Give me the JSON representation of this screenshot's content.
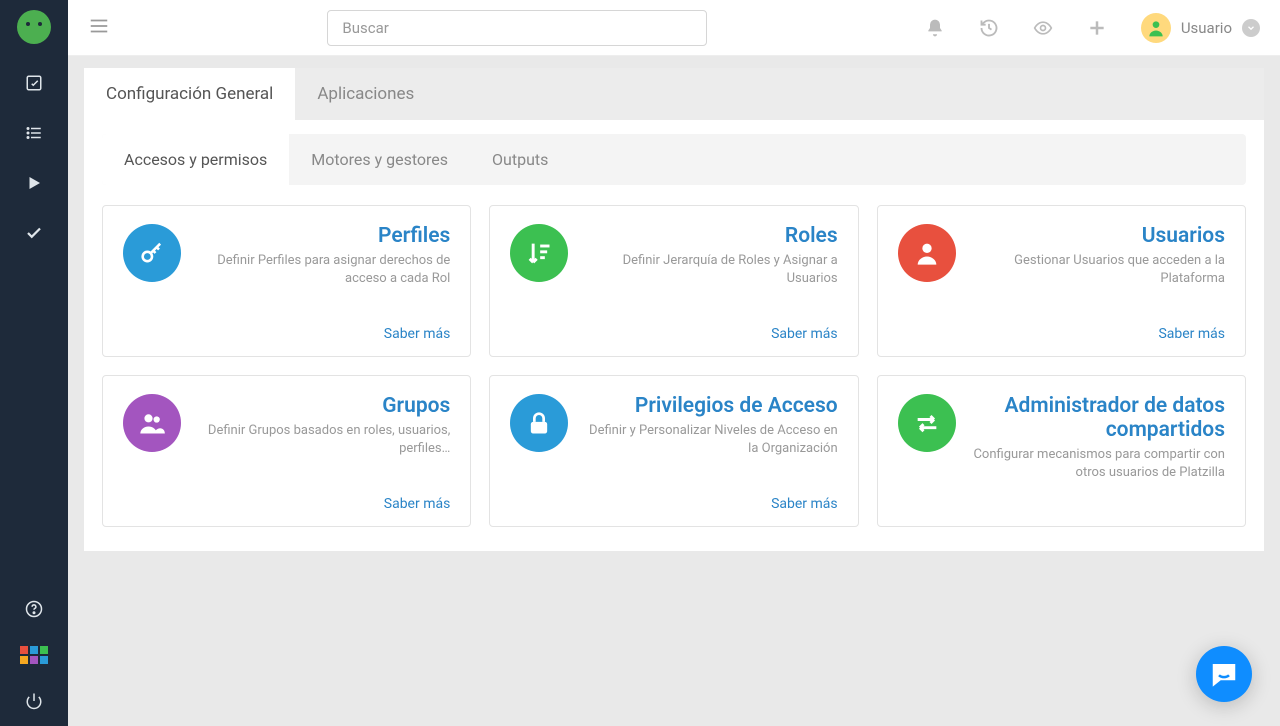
{
  "search": {
    "placeholder": "Buscar"
  },
  "user": {
    "name": "Usuario"
  },
  "tabs1": [
    {
      "label": "Configuración General",
      "active": true
    },
    {
      "label": "Aplicaciones",
      "active": false
    }
  ],
  "tabs2": [
    {
      "label": "Accesos y permisos",
      "active": true
    },
    {
      "label": "Motores y gestores",
      "active": false
    },
    {
      "label": "Outputs",
      "active": false
    }
  ],
  "more_label": "Saber más",
  "cards": [
    {
      "icon": "key",
      "color": "blue",
      "title": "Perfiles",
      "desc": "Definir Perfiles para asignar derechos de acceso a cada Rol",
      "show_more": true
    },
    {
      "icon": "sort-down",
      "color": "green",
      "title": "Roles",
      "desc": "Definir Jerarquía de Roles y Asignar a Usuarios",
      "show_more": true
    },
    {
      "icon": "user",
      "color": "red",
      "title": "Usuarios",
      "desc": "Gestionar Usuarios que acceden a la Plataforma",
      "show_more": true
    },
    {
      "icon": "users",
      "color": "purple",
      "title": "Grupos",
      "desc": "Definir Grupos basados en roles, usuarios, perfiles…",
      "show_more": true
    },
    {
      "icon": "lock",
      "color": "blue",
      "title": "Privilegios de Acceso",
      "desc": "Definir y Personalizar Niveles de Acceso en la Organización",
      "show_more": true
    },
    {
      "icon": "exchange",
      "color": "green",
      "title": "Administrador de datos compartidos",
      "desc": "Configurar mecanismos para compartir con otros usuarios de Platzilla",
      "show_more": false
    }
  ],
  "grid_colors": [
    "#e8503e",
    "#2a9bd8",
    "#3cc051",
    "#f6a821",
    "#a355bf",
    "#2a9bd8"
  ]
}
